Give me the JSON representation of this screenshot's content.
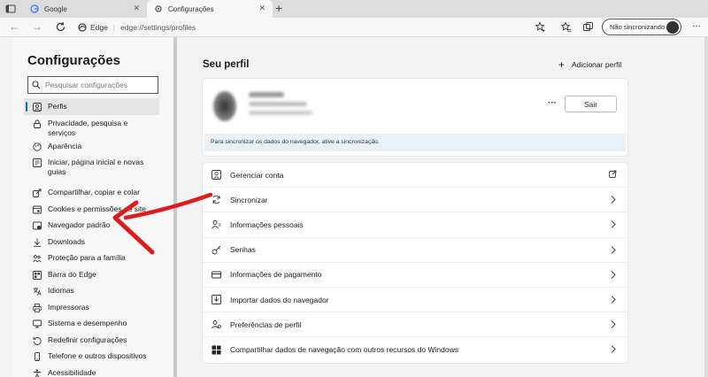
{
  "tabs": [
    {
      "label": "Google",
      "icon": "google-g-icon"
    },
    {
      "label": "Configurações",
      "icon": "gear-icon"
    }
  ],
  "address": {
    "site": "Edge",
    "url": "edge://settings/profiles"
  },
  "sync_pill": "Não sincronizando",
  "sidebar": {
    "title": "Configurações",
    "search_placeholder": "Pesquisar configurações",
    "items": [
      {
        "label": "Perfis",
        "icon": "profile-icon",
        "active": true
      },
      {
        "label": "Privacidade, pesquisa e serviços",
        "icon": "lock-icon"
      },
      {
        "label": "Aparência",
        "icon": "appearance-icon"
      },
      {
        "label": "Iniciar, página inicial e novas guias",
        "icon": "start-page-icon"
      },
      {
        "label": "Compartilhar, copiar e colar",
        "icon": "share-icon"
      },
      {
        "label": "Cookies e permissões de site",
        "icon": "cookies-icon"
      },
      {
        "label": "Navegador padrão",
        "icon": "default-browser-icon"
      },
      {
        "label": "Downloads",
        "icon": "download-icon"
      },
      {
        "label": "Proteção para a família",
        "icon": "family-icon"
      },
      {
        "label": "Barra do Edge",
        "icon": "edge-bar-icon"
      },
      {
        "label": "Idiomas",
        "icon": "language-icon"
      },
      {
        "label": "Impressoras",
        "icon": "printer-icon"
      },
      {
        "label": "Sistema e desempenho",
        "icon": "system-icon"
      },
      {
        "label": "Redefinir configurações",
        "icon": "reset-icon"
      },
      {
        "label": "Telefone e outros dispositivos",
        "icon": "phone-icon"
      },
      {
        "label": "Acessibilidade",
        "icon": "accessibility-icon"
      }
    ]
  },
  "main": {
    "title": "Seu perfil",
    "add_profile": "Adicionar perfil",
    "profile": {
      "sign_out": "Sair",
      "sync_notice": "Para sincronizar os dados do navegador, ative a sincronização."
    },
    "rows": [
      {
        "label": "Gerenciar conta",
        "icon": "account-icon",
        "action": "external-link-icon"
      },
      {
        "label": "Sincronizar",
        "icon": "sync-icon",
        "action": "chevron-right-icon"
      },
      {
        "label": "Informações pessoais",
        "icon": "personal-info-icon",
        "action": "chevron-right-icon"
      },
      {
        "label": "Senhas",
        "icon": "key-icon",
        "action": "chevron-right-icon"
      },
      {
        "label": "Informações de pagamento",
        "icon": "card-icon",
        "action": "chevron-right-icon"
      },
      {
        "label": "Importar dados do navegador",
        "icon": "import-icon",
        "action": "chevron-right-icon"
      },
      {
        "label": "Preferências de perfil",
        "icon": "profile-prefs-icon",
        "action": "chevron-right-icon"
      },
      {
        "label": "Compartilhar dados de navegação com outros recursos do Windows",
        "icon": "windows-icon",
        "action": "chevron-right-icon"
      }
    ]
  },
  "colors": {
    "accent": "#0f6cbd",
    "annotation_arrow": "#e01b1b",
    "sync_banner": "#e9f1f8"
  }
}
